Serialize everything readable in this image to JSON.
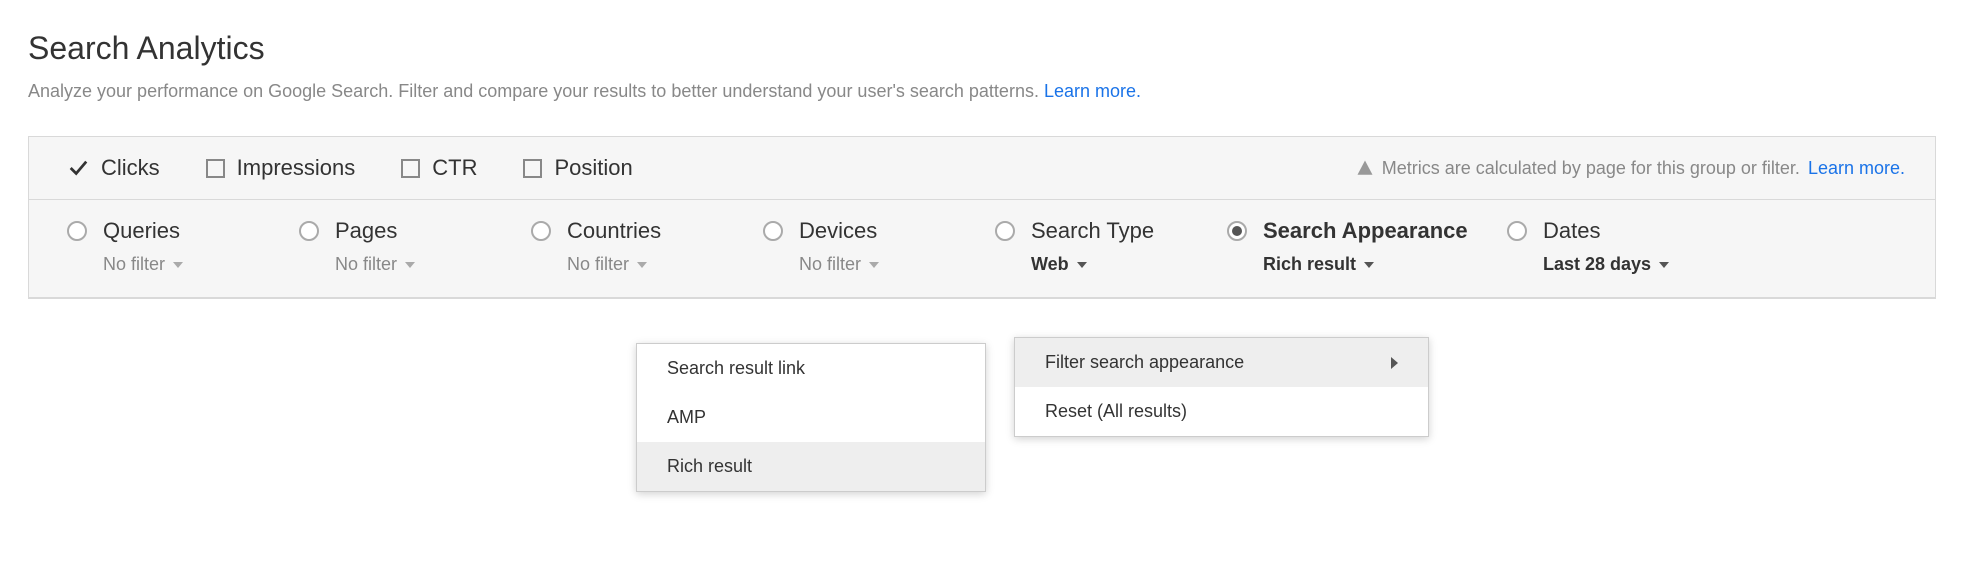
{
  "header": {
    "title": "Search Analytics",
    "subtitle_text": "Analyze your performance on Google Search. Filter and compare your results to better understand your user's search patterns. ",
    "learn_more": "Learn more."
  },
  "metrics": {
    "items": [
      {
        "label": "Clicks",
        "checked": true
      },
      {
        "label": "Impressions",
        "checked": false
      },
      {
        "label": "CTR",
        "checked": false
      },
      {
        "label": "Position",
        "checked": false
      }
    ],
    "note_text": "Metrics are calculated by page for this group or filter. ",
    "note_link": "Learn more."
  },
  "dimensions": {
    "queries": {
      "title": "Queries",
      "filter": "No filter",
      "selected": false
    },
    "pages": {
      "title": "Pages",
      "filter": "No filter",
      "selected": false
    },
    "countries": {
      "title": "Countries",
      "filter": "No filter",
      "selected": false
    },
    "devices": {
      "title": "Devices",
      "filter": "No filter",
      "selected": false
    },
    "search_type": {
      "title": "Search Type",
      "filter": "Web",
      "selected": false
    },
    "search_appearance": {
      "title": "Search Appearance",
      "filter": "Rich result",
      "selected": true
    },
    "dates": {
      "title": "Dates",
      "filter": "Last 28 days",
      "selected": false
    }
  },
  "appearance_menu": {
    "items": [
      {
        "label": "Filter search appearance",
        "hover": true,
        "submenu": true
      },
      {
        "label": "Reset (All results)",
        "hover": false,
        "submenu": false
      }
    ]
  },
  "appearance_submenu": {
    "items": [
      {
        "label": "Search result link",
        "hover": false
      },
      {
        "label": "AMP",
        "hover": false
      },
      {
        "label": "Rich result",
        "hover": true
      }
    ]
  }
}
